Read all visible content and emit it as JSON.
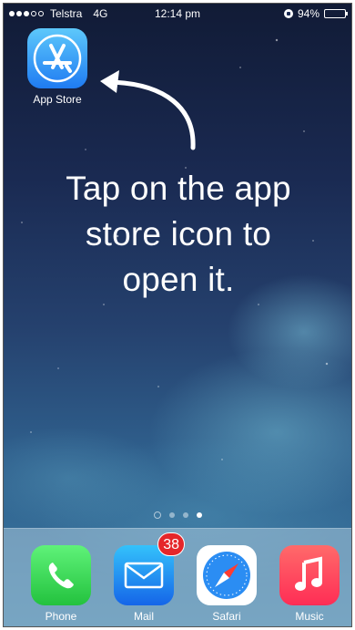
{
  "status_bar": {
    "carrier": "Telstra",
    "network": "4G",
    "time": "12:14 pm",
    "battery": "94%",
    "battery_level": 0.94,
    "signal_bars": 3,
    "signal_total": 5
  },
  "home": {
    "app_store_label": "App Store",
    "instruction": "Tap on the app\nstore icon to\nopen it.",
    "page_count": 3,
    "active_page": 3
  },
  "dock": {
    "items": [
      {
        "label": "Phone",
        "icon": "phone-icon",
        "color": "#4cd964"
      },
      {
        "label": "Mail",
        "icon": "mail-icon",
        "color": "#1e88f5",
        "badge": "38"
      },
      {
        "label": "Safari",
        "icon": "safari-icon",
        "color": "#ffffff"
      },
      {
        "label": "Music",
        "icon": "music-icon",
        "color": "#ff3b4e"
      }
    ]
  }
}
